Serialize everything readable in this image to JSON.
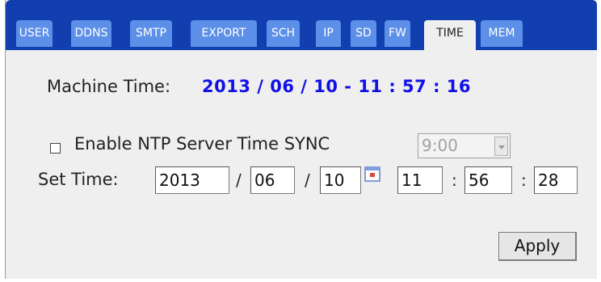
{
  "tabs": [
    {
      "label": "USER"
    },
    {
      "label": "DDNS"
    },
    {
      "label": "SMTP"
    },
    {
      "label": "EXPORT"
    },
    {
      "label": "SCH"
    },
    {
      "label": "IP"
    },
    {
      "label": "SD"
    },
    {
      "label": "FW"
    },
    {
      "label": "TIME",
      "active": true
    },
    {
      "label": "MEM"
    }
  ],
  "machine_time": {
    "label": "Machine Time:",
    "value": "2013 / 06 / 10 - 11 : 57 : 16"
  },
  "ntp": {
    "label": "Enable NTP Server Time SYNC",
    "checked": false,
    "select_value": "9:00"
  },
  "set_time": {
    "label": "Set Time:",
    "year": "2013",
    "month": "06",
    "day": "10",
    "hour": "11",
    "minute": "56",
    "second": "28",
    "date_sep": "/",
    "time_sep": ":"
  },
  "apply_label": "Apply",
  "colors": {
    "tab_bar": "#123fb0",
    "tab": "#5b8fe8",
    "time_value": "#1010e6",
    "panel": "#efefef"
  }
}
